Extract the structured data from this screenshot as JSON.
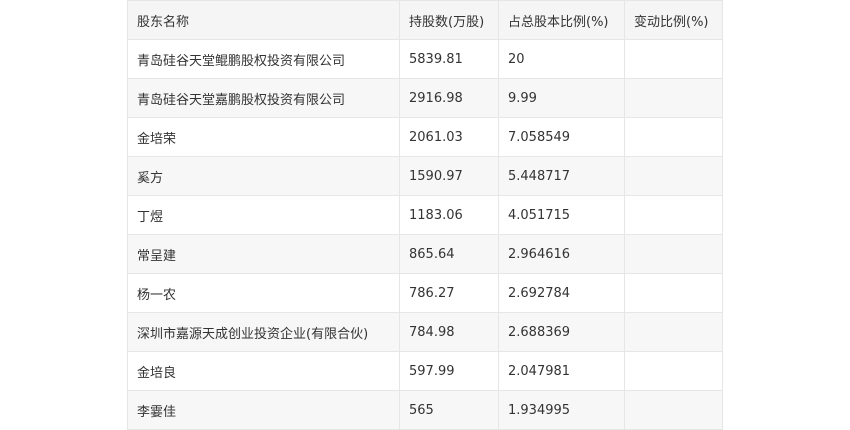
{
  "table": {
    "headers": [
      "股东名称",
      "持股数(万股)",
      "占总股本比例(%)",
      "变动比例(%)"
    ],
    "rows": [
      [
        "青岛硅谷天堂鲲鹏股权投资有限公司",
        "5839.81",
        "20",
        ""
      ],
      [
        "青岛硅谷天堂嘉鹏股权投资有限公司",
        "2916.98",
        "9.99",
        ""
      ],
      [
        "金培荣",
        "2061.03",
        "7.058549",
        ""
      ],
      [
        "奚方",
        "1590.97",
        "5.448717",
        ""
      ],
      [
        "丁煜",
        "1183.06",
        "4.051715",
        ""
      ],
      [
        "常呈建",
        "865.64",
        "2.964616",
        ""
      ],
      [
        "杨一农",
        "786.27",
        "2.692784",
        ""
      ],
      [
        "深圳市嘉源天成创业投资企业(有限合伙)",
        "784.98",
        "2.688369",
        ""
      ],
      [
        "金培良",
        "597.99",
        "2.047981",
        ""
      ],
      [
        "李霎佳",
        "565",
        "1.934995",
        ""
      ]
    ]
  }
}
